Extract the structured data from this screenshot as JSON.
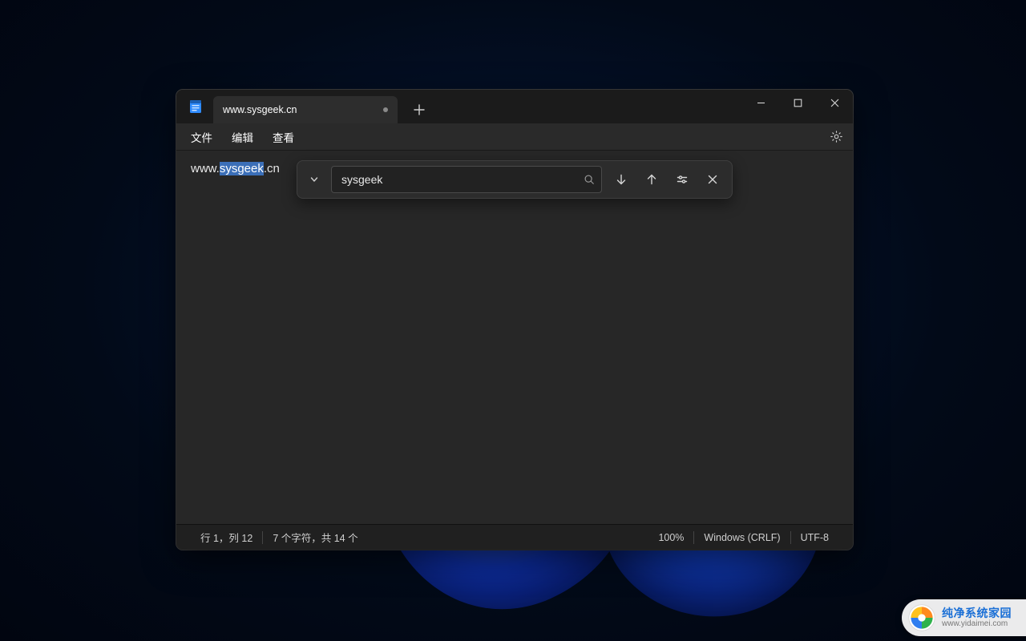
{
  "tab": {
    "title": "www.sysgeek.cn"
  },
  "menubar": {
    "file": "文件",
    "edit": "编辑",
    "view": "查看"
  },
  "editor": {
    "line": {
      "pre": "www.",
      "match": "sysgeek",
      "post": ".cn"
    }
  },
  "find": {
    "value": "sysgeek"
  },
  "statusbar": {
    "position": "行 1，列 12",
    "selection": "7 个字符，共 14 个",
    "zoom": "100%",
    "lineEnding": "Windows (CRLF)",
    "encoding": "UTF-8"
  },
  "watermark": {
    "title": "纯净系统家园",
    "sub": "www.yidaimei.com"
  }
}
